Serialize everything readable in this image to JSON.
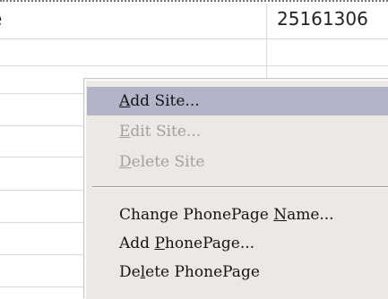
{
  "table": {
    "left_cell_fragment": "e",
    "number_cell": "25161306"
  },
  "menu": {
    "items": [
      {
        "pre": "",
        "ul": "A",
        "post": "dd Site...",
        "state": "highlighted"
      },
      {
        "pre": "",
        "ul": "E",
        "post": "dit Site...",
        "state": "disabled"
      },
      {
        "pre": "",
        "ul": "D",
        "post": "elete Site",
        "state": "disabled"
      },
      {
        "pre": "Change PhonePage ",
        "ul": "N",
        "post": "ame...",
        "state": "enabled"
      },
      {
        "pre": "Add ",
        "ul": "P",
        "post": "honePage...",
        "state": "enabled"
      },
      {
        "pre": "De",
        "ul": "l",
        "post": "ete PhonePage",
        "state": "enabled"
      }
    ]
  }
}
